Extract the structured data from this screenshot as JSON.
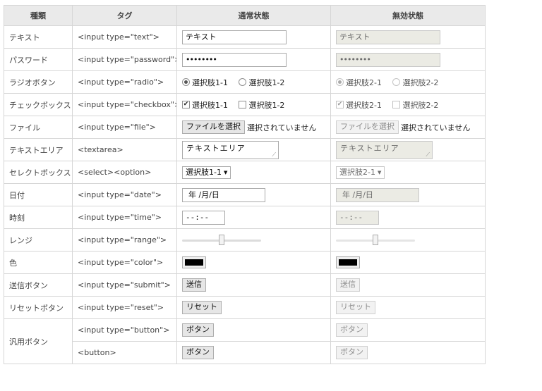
{
  "headers": {
    "kind": "種類",
    "tag": "タグ",
    "normal": "通常状態",
    "disabled": "無効状態"
  },
  "rows": {
    "text": {
      "kind": "テキスト",
      "tag": "<input type=\"text\">",
      "value": "テキスト"
    },
    "password": {
      "kind": "パスワード",
      "tag": "<input type=\"password\">",
      "value": "••••••••"
    },
    "radio": {
      "kind": "ラジオボタン",
      "tag": "<input type=\"radio\">",
      "normal_options": [
        "選択肢1-1",
        "選択肢1-2"
      ],
      "disabled_options": [
        "選択肢2-1",
        "選択肢2-2"
      ]
    },
    "checkbox": {
      "kind": "チェックボックス",
      "tag": "<input type=\"checkbox\">",
      "normal_options": [
        "選択肢1-1",
        "選択肢1-2"
      ],
      "disabled_options": [
        "選択肢2-1",
        "選択肢2-2"
      ]
    },
    "file": {
      "kind": "ファイル",
      "tag": "<input type=\"file\">",
      "button": "ファイルを選択",
      "status": "選択されていません"
    },
    "textarea": {
      "kind": "テキストエリア",
      "tag": "<textarea>",
      "value": "テキストエリア"
    },
    "select": {
      "kind": "セレクトボックス",
      "tag": "<select><option>",
      "normal_selected": "選択肢1-1",
      "disabled_selected": "選択肢2-1"
    },
    "date": {
      "kind": "日付",
      "tag": "<input type=\"date\">",
      "value": "年 /月/日"
    },
    "time": {
      "kind": "時刻",
      "tag": "<input type=\"time\">",
      "value": "--:--"
    },
    "range": {
      "kind": "レンジ",
      "tag": "<input type=\"range\">",
      "value": 0.5
    },
    "color": {
      "kind": "色",
      "tag": "<input type=\"color\">",
      "value": "#000000"
    },
    "submit": {
      "kind": "送信ボタン",
      "tag": "<input type=\"submit\">",
      "label": "送信"
    },
    "reset": {
      "kind": "リセットボタン",
      "tag": "<input type=\"reset\">",
      "label": "リセット"
    },
    "generic": {
      "kind": "汎用ボタン",
      "tag_input": "<input type=\"button\">",
      "tag_button": "<button>",
      "label": "ボタン"
    }
  }
}
